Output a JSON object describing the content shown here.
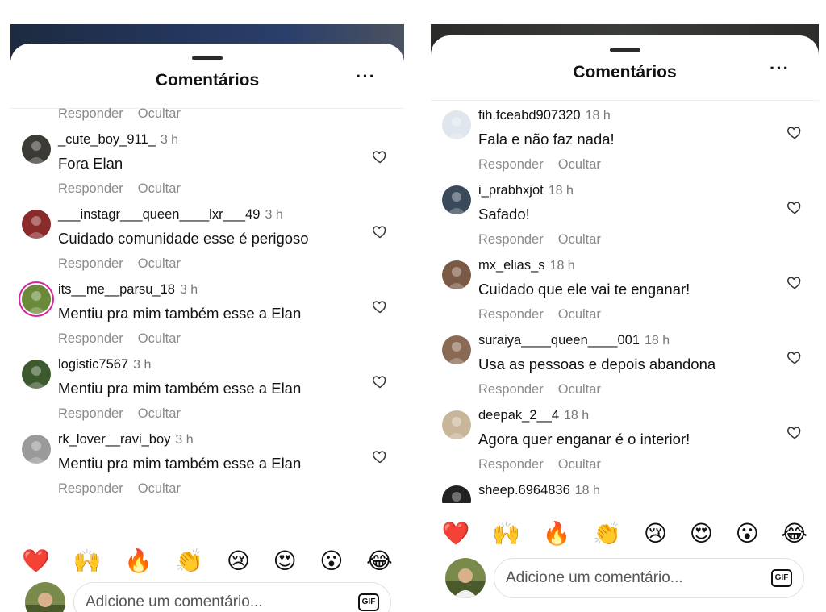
{
  "left": {
    "title": "Comentários",
    "more": "···",
    "partial_top_actions": {
      "reply": "Responder",
      "hide": "Ocultar"
    },
    "comments": [
      {
        "username": "_cute_boy_911_",
        "time": "3 h",
        "text": "Fora Elan",
        "reply": "Responder",
        "hide": "Ocultar",
        "avatar": "#3b3a35"
      },
      {
        "username": "___instagr___queen____lxr___49",
        "time": "3 h",
        "text": "Cuidado comunidade esse é perigoso",
        "reply": "Responder",
        "hide": "Ocultar",
        "avatar": "#8a2a2a"
      },
      {
        "username": "its__me__parsu_18",
        "time": "3 h",
        "text": "Mentiu pra mim também esse a Elan",
        "reply": "Responder",
        "hide": "Ocultar",
        "avatar": "#6a8a3a"
      },
      {
        "username": "logistic7567",
        "time": "3 h",
        "text": "Mentiu pra mim também esse a Elan",
        "reply": "Responder",
        "hide": "Ocultar",
        "avatar": "#3d5a2e"
      },
      {
        "username": "rk_lover__ravi_boy",
        "time": "3 h",
        "text": "Mentiu pra mim também esse a Elan",
        "reply": "Responder",
        "hide": "Ocultar",
        "avatar": "#9a9a9a"
      }
    ],
    "emojis": [
      "❤️",
      "🙌",
      "🔥",
      "👏",
      "😢",
      "😍",
      "😮",
      "😂"
    ],
    "input_placeholder": "Adicione um comentário...",
    "gif_label": "GIF"
  },
  "right": {
    "title": "Comentários",
    "more": "···",
    "comments": [
      {
        "username": "fih.fceabd907320",
        "time": "18 h",
        "text": "Fala e não faz nada!",
        "reply": "Responder",
        "hide": "Ocultar",
        "avatar": "#dfe6ee"
      },
      {
        "username": "i_prabhxjot",
        "time": "18 h",
        "text": "Safado!",
        "reply": "Responder",
        "hide": "Ocultar",
        "avatar": "#3a4a5a"
      },
      {
        "username": "mx_elias_s",
        "time": "18 h",
        "text": "Cuidado que ele vai te enganar!",
        "reply": "Responder",
        "hide": "Ocultar",
        "avatar": "#7a5a45"
      },
      {
        "username": "suraiya____queen____001",
        "time": "18 h",
        "text": "Usa as pessoas e depois abandona",
        "reply": "Responder",
        "hide": "Ocultar",
        "avatar": "#8a6a55"
      },
      {
        "username": "deepak_2__4",
        "time": "18 h",
        "text": "Agora quer enganar é o interior!",
        "reply": "Responder",
        "hide": "Ocultar",
        "avatar": "#c9b59a"
      }
    ],
    "partial_comment": {
      "username": "sheep.6964836",
      "time": "18 h",
      "avatar": "#222222"
    },
    "emojis": [
      "❤️",
      "🙌",
      "🔥",
      "👏",
      "😢",
      "😍",
      "😮",
      "😂"
    ],
    "input_placeholder": "Adicione um comentário...",
    "gif_label": "GIF"
  }
}
